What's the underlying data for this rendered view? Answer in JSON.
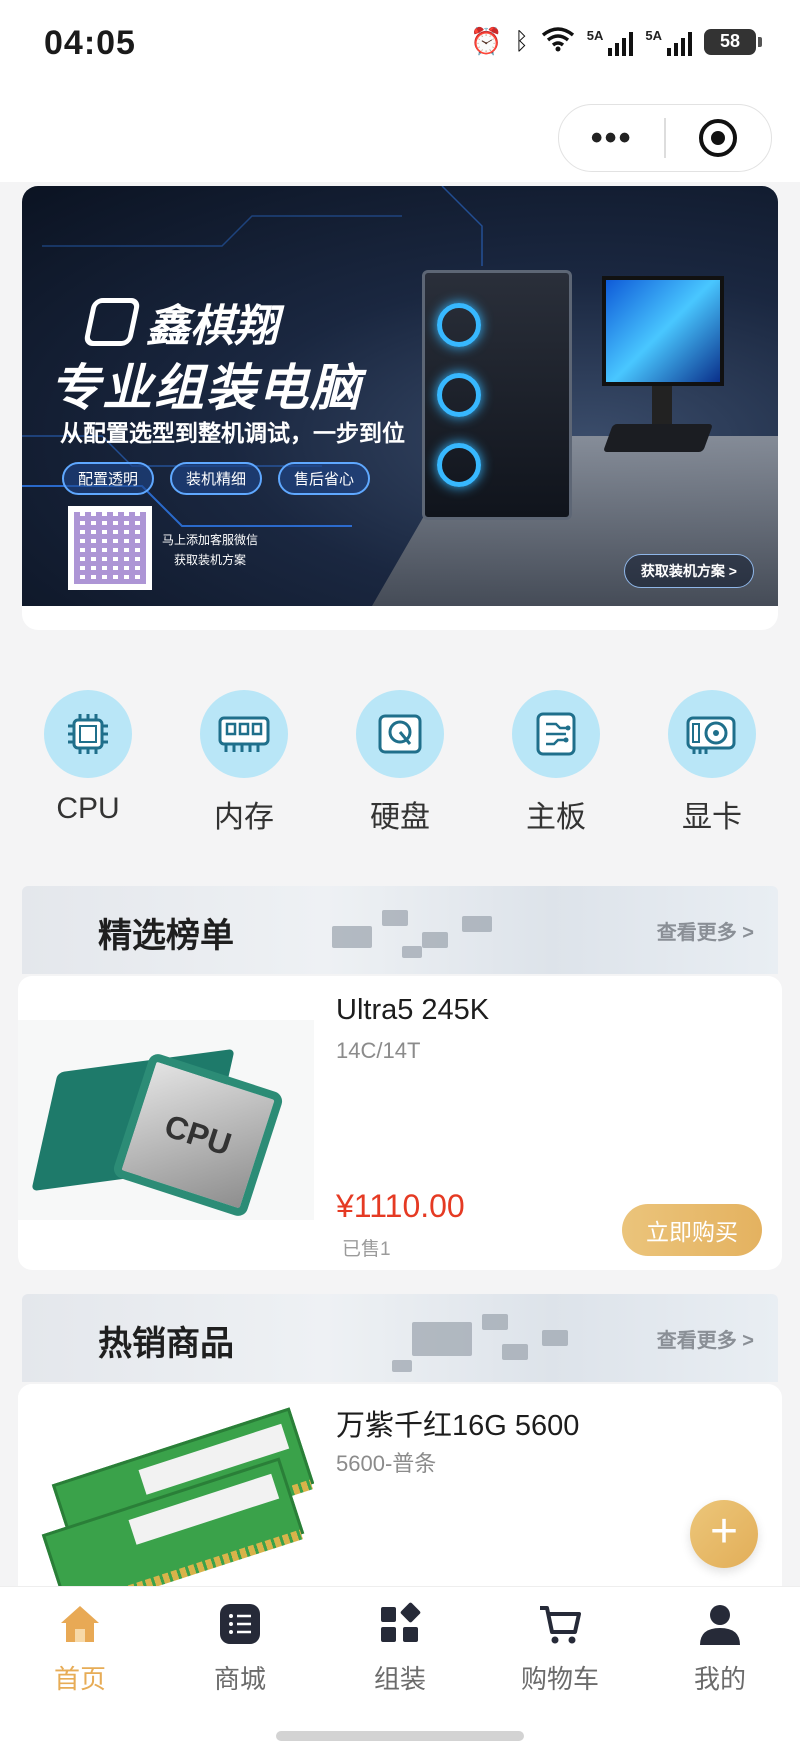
{
  "status_bar": {
    "time": "04:05",
    "signal1": "5A",
    "signal2": "5A",
    "battery": "58"
  },
  "banner": {
    "brand": "鑫棋翔",
    "title": "专业组装电脑",
    "subtitle": "从配置选型到整机调试，一步到位",
    "tags": [
      "配置透明",
      "装机精细",
      "售后省心"
    ],
    "qr_text_1": "马上添加客服微信",
    "qr_text_2": "获取装机方案",
    "cta": "获取装机方案 >"
  },
  "categories": [
    {
      "label": "CPU",
      "icon": "cpu-icon"
    },
    {
      "label": "内存",
      "icon": "memory-icon"
    },
    {
      "label": "硬盘",
      "icon": "hard-disk-icon"
    },
    {
      "label": "主板",
      "icon": "motherboard-icon"
    },
    {
      "label": "显卡",
      "icon": "graphics-card-icon"
    }
  ],
  "sections": {
    "featured": {
      "title": "精选榜单",
      "more": "查看更多 >",
      "product": {
        "name": "Ultra5 245K",
        "spec": "14C/14T",
        "price": "¥1110.00",
        "sold": "已售1",
        "buy": "立即购买"
      }
    },
    "hot": {
      "title": "热销商品",
      "more": "查看更多 >",
      "product": {
        "name": "万紫千红16G 5600",
        "spec": "5600-普条"
      }
    }
  },
  "fab_label": "+",
  "tabbar": [
    {
      "label": "首页",
      "icon": "home-icon",
      "active": true
    },
    {
      "label": "商城",
      "icon": "list-icon",
      "active": false
    },
    {
      "label": "组装",
      "icon": "grid-icon",
      "active": false
    },
    {
      "label": "购物车",
      "icon": "cart-icon",
      "active": false
    },
    {
      "label": "我的",
      "icon": "user-icon",
      "active": false
    }
  ],
  "colors": {
    "accent": "#e7ac56",
    "price": "#e53a23",
    "category_bg": "#b9e6f7"
  }
}
